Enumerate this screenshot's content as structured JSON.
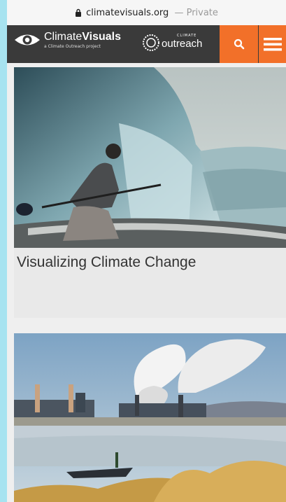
{
  "browser": {
    "url": "climatevisuals.org",
    "separator": "—",
    "mode": "Private"
  },
  "header": {
    "brand_prefix": "Climate",
    "brand_suffix": "Visuals",
    "tagline": "a Climate Outreach project",
    "partner_small": "CLIMATE",
    "partner_big": "outreach",
    "accent_color": "#f27029",
    "search_icon": "search-icon",
    "menu_icon": "hamburger-menu-icon"
  },
  "cards": [
    {
      "title": "Visualizing Climate Change"
    },
    {
      "title": ""
    }
  ]
}
